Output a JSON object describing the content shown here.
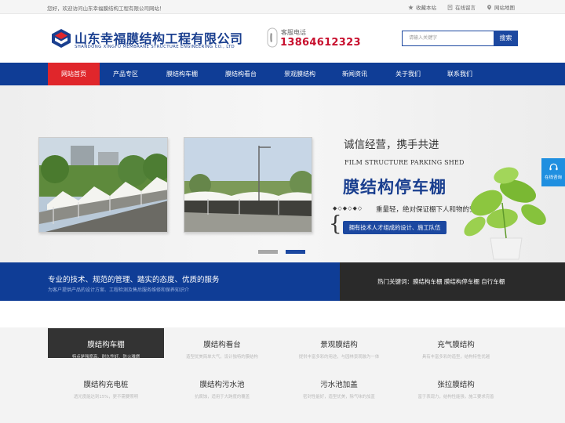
{
  "topbar": {
    "welcome": "您好，欢迎访问山东幸福膜结构工程有限公司网站！",
    "links": [
      "收藏本站",
      "在线留言",
      "网站地图"
    ]
  },
  "header": {
    "company_cn": "山东幸福膜结构工程有限公司",
    "company_en": "SHANDONG XINGFU MEMBRANE STRUCTURE ENGINEERING CO., LTD",
    "phone_label": "客服电话",
    "phone_number": "13864612323",
    "search_placeholder": "请输入关键字",
    "search_button": "搜索"
  },
  "nav": {
    "items": [
      "网站首页",
      "产品专区",
      "膜结构车棚",
      "膜结构看台",
      "景观膜结构",
      "新闻资讯",
      "关于我们",
      "联系我们"
    ],
    "active_index": 0
  },
  "banner": {
    "slogan_cn": "诚信经营，携手共进",
    "slogan_en": "FILM STRUCTURE PARKING SHED",
    "title": "膜结构停车棚",
    "dots": "◆◇◆◇◆◇",
    "feature": "重量轻，绝对保证棚下人和物的安全",
    "brace": "{",
    "tag": "拥有技术人才组成的设计、施工队伍",
    "active_slide": 2
  },
  "sidefloat": {
    "label": "在线咨询"
  },
  "strip": {
    "title": "专业的技术、规范的管理、踏实的态度、优质的服务",
    "subtitle": "为客户提供产品的设计方案、工程检测及售后服务维修和保养知识介",
    "hot_keywords": "热门关键词：膜结构车棚 膜结构停车棚 自行车棚"
  },
  "products": [
    {
      "title": "膜结构车棚",
      "desc": "特点是强度高、耐久性好、防火难燃",
      "active": true
    },
    {
      "title": "膜结构看台",
      "desc": "造型优美简单大气，设计独特的膜结构"
    },
    {
      "title": "景观膜结构",
      "desc": "提供丰富多彩的用途，与园林景观融为一体"
    },
    {
      "title": "充气膜结构",
      "desc": "具有丰富多彩的造型，结构特性优越"
    },
    {
      "title": "膜结构充电桩",
      "desc": "透光度能达到15%，更不需要照明"
    },
    {
      "title": "膜结构污水池",
      "desc": "抗腐蚀，适用于大跨度的覆盖"
    },
    {
      "title": "污水池加盖",
      "desc": "密封性能好，造型优美，除气味的加盖"
    },
    {
      "title": "张拉膜结构",
      "desc": "富于表现力，结构性能强，施工要求完善"
    }
  ],
  "colors": {
    "brand_blue": "#0f3d96",
    "accent_red": "#e0262b",
    "phone_red": "#c8102e",
    "strip_dark": "#2a2a2a",
    "float_blue": "#1f8fe0"
  }
}
